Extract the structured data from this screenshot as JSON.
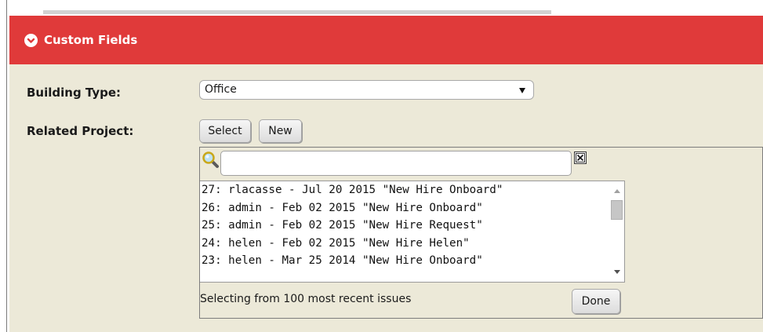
{
  "panel": {
    "title": "Custom Fields",
    "accent_color": "#e03a3a",
    "icon": "chevron-down-circle-icon"
  },
  "fields": {
    "building_type": {
      "label": "Building Type:",
      "selected": "Office"
    },
    "related_project": {
      "label": "Related Project:",
      "select_label": "Select",
      "new_label": "New"
    }
  },
  "picker": {
    "search_value": "",
    "search_icon": "magnifier-icon",
    "clear_icon": "clear-x-icon",
    "items": [
      "27: rlacasse - Jul 20 2015 \"New Hire Onboard\"",
      "26: admin - Feb 02 2015 \"New Hire Onboard\"",
      "25: admin - Feb 02 2015 \"New Hire Request\"",
      "24: helen - Feb 02 2015 \"New Hire Helen\"",
      "23: helen - Mar 25 2014 \"New Hire Onboard\""
    ],
    "status": "Selecting from 100 most recent issues",
    "done_label": "Done"
  }
}
